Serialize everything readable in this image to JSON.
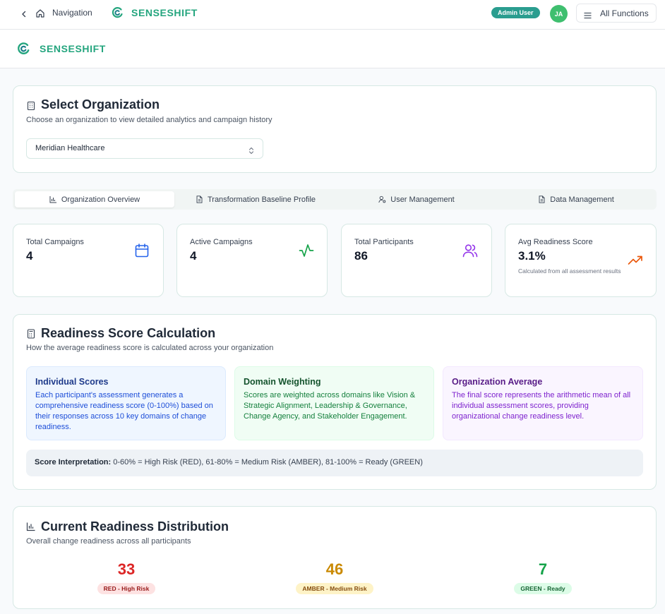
{
  "topbar": {
    "nav_label": "Navigation",
    "brand": "SENSESHIFT",
    "role_badge": "Admin User",
    "avatar_initials": "JA",
    "all_functions": "All Functions"
  },
  "header": {
    "brand": "SENSESHIFT"
  },
  "select_org": {
    "title": "Select Organization",
    "subtitle": "Choose an organization to view detailed analytics and campaign history",
    "selected": "Meridian Healthcare"
  },
  "tabs": [
    {
      "label": "Organization Overview",
      "icon": "bar-chart-icon",
      "active": true
    },
    {
      "label": "Transformation Baseline Profile",
      "icon": "file-icon",
      "active": false
    },
    {
      "label": "User Management",
      "icon": "user-gear-icon",
      "active": false
    },
    {
      "label": "Data Management",
      "icon": "file-icon",
      "active": false
    }
  ],
  "stats": [
    {
      "label": "Total Campaigns",
      "value": "4",
      "icon": "calendar-icon",
      "color": "#2563eb"
    },
    {
      "label": "Active Campaigns",
      "value": "4",
      "icon": "activity-icon",
      "color": "#16a34a"
    },
    {
      "label": "Total Participants",
      "value": "86",
      "icon": "users-icon",
      "color": "#9333ea"
    },
    {
      "label": "Avg Readiness Score",
      "value": "3.1%",
      "note": "Calculated from all assessment results",
      "icon": "trending-up-icon",
      "color": "#ea580c"
    }
  ],
  "calc": {
    "title": "Readiness Score Calculation",
    "subtitle": "How the average readiness score is calculated across your organization",
    "boxes": [
      {
        "title": "Individual Scores",
        "body": "Each participant's assessment generates a comprehensive readiness score (0-100%) based on their responses across 10 key domains of change readiness."
      },
      {
        "title": "Domain Weighting",
        "body": "Scores are weighted across domains like Vision & Strategic Alignment, Leadership & Governance, Change Agency, and Stakeholder Engagement."
      },
      {
        "title": "Organization Average",
        "body": "The final score represents the arithmetic mean of all individual assessment scores, providing organizational change readiness level."
      }
    ],
    "interpretation_label": "Score Interpretation:",
    "interpretation_text": " 0-60% = High Risk (RED), 61-80% = Medium Risk (AMBER), 81-100% = Ready (GREEN)"
  },
  "distribution": {
    "title": "Current Readiness Distribution",
    "subtitle": "Overall change readiness across all participants",
    "items": [
      {
        "value": "33",
        "label": "RED - High Risk",
        "color": "#dc2626",
        "badge_bg": "#fde2e2",
        "badge_fg": "#991b1b"
      },
      {
        "value": "46",
        "label": "AMBER - Medium Risk",
        "color": "#ca8a04",
        "badge_bg": "#fef3c7",
        "badge_fg": "#854d0e"
      },
      {
        "value": "7",
        "label": "GREEN - Ready",
        "color": "#16a34a",
        "badge_bg": "#dcfce7",
        "badge_fg": "#166534"
      }
    ]
  },
  "colors": {
    "brand": "#24a57e",
    "accent": "#2a9d8f"
  }
}
